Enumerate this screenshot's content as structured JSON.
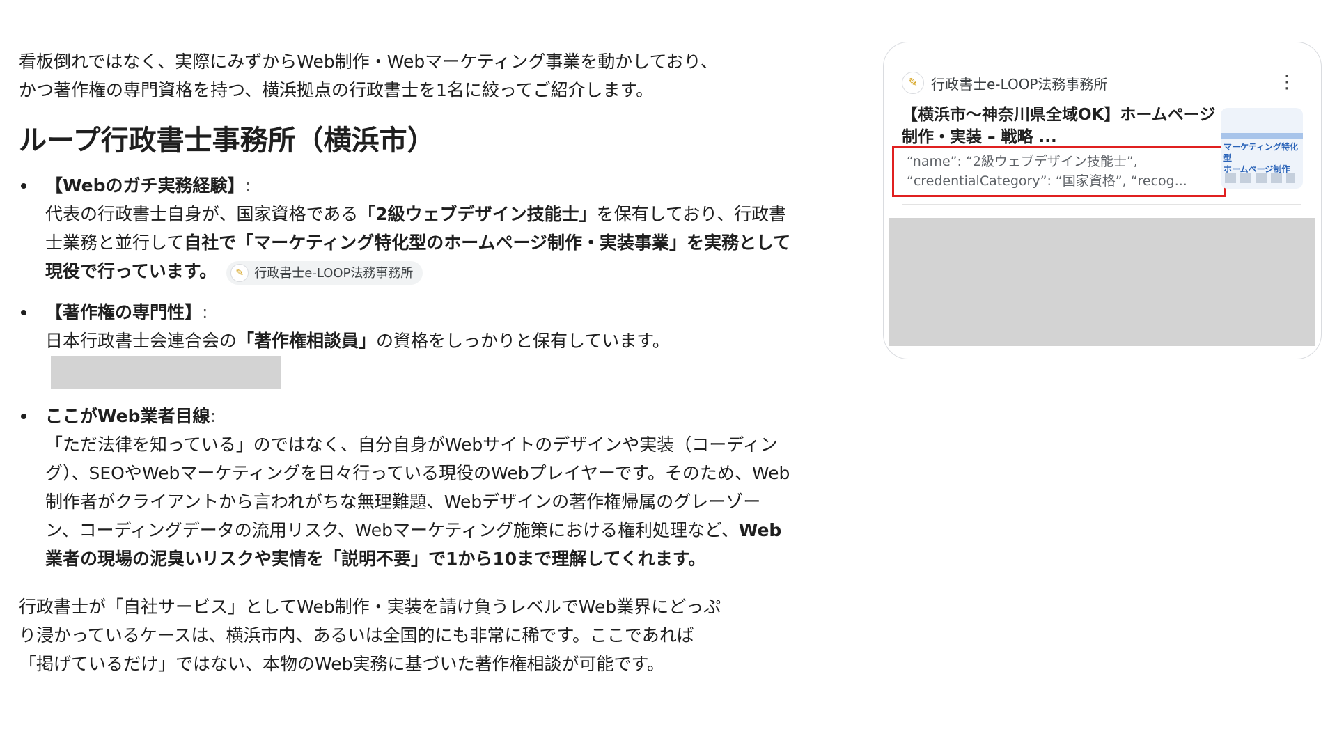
{
  "main": {
    "intro": "看板倒れではなく、実際にみずからWeb制作・Webマーケティング事業を動かしており、\nかつ著作権の専門資格を持つ、横浜拠点の行政書士を1名に絞ってご紹介します。",
    "section_title": "ループ行政書士事務所（横浜市）",
    "points": [
      {
        "heading": "【Webのガチ実務経験】",
        "text_1": "代表の行政書士自身が、国家資格である",
        "bold_1": "「2級ウェブデザイン技能士」",
        "text_2": "を保有しており、行政書士業務と並行して",
        "bold_2": "自社で「マーケティング特化型のホームページ制作・実装事業」を実務として現役で行っています。",
        "chip_label": "行政書士e-LOOP法務事務所"
      },
      {
        "heading": "【著作権の専門性】",
        "text_1": "日本行政書士会連合会の",
        "bold_1": "「著作権相談員」",
        "text_2": "の資格をしっかりと保有しています。"
      },
      {
        "heading": "ここがWeb業者目線",
        "text_1": "「ただ法律を知っている」のではなく、自分自身がWebサイトのデザインや実装（コーディング）、SEOやWebマーケティングを日々行っている現役のWebプレイヤーです。そのため、Web制作者がクライアントから言われがちな無理難題、Webデザインの著作権帰属のグレーゾーン、コーディングデータの流用リスク、Webマーケティング施策における権利処理など、",
        "bold_1": "Web業者の現場の泥臭いリスクや実情を「説明不要」で1から10まで理解してくれます。"
      }
    ],
    "outro": "行政書士が「自社サービス」としてWeb制作・実装を請け負うレベルでWeb業界にどっぷ\nり浸かっているケースは、横浜市内、あるいは全国的にも非常に稀です。ここであれば\n「掲げているだけ」ではない、本物のWeb実務に基づいた著作権相談が可能です。"
  },
  "source_card": {
    "site_name": "行政書士e-LOOP法務事務所",
    "menu_icon": "⋮",
    "title": "【横浜市〜神奈川県全域OK】ホームページ制作・実装 – 戦略 ...",
    "snippet_line_1": "“name”: “2級ウェブデザイン技能士”,",
    "snippet_line_2": "“credentialCategory”: “国家資格”, “recog...",
    "thumbnail_text": "マーケティング特化型\nホームページ制作"
  },
  "colors": {
    "highlight_border": "#e02020",
    "redaction": "#d3d3d3",
    "chip_bg": "#f1f3f4"
  }
}
